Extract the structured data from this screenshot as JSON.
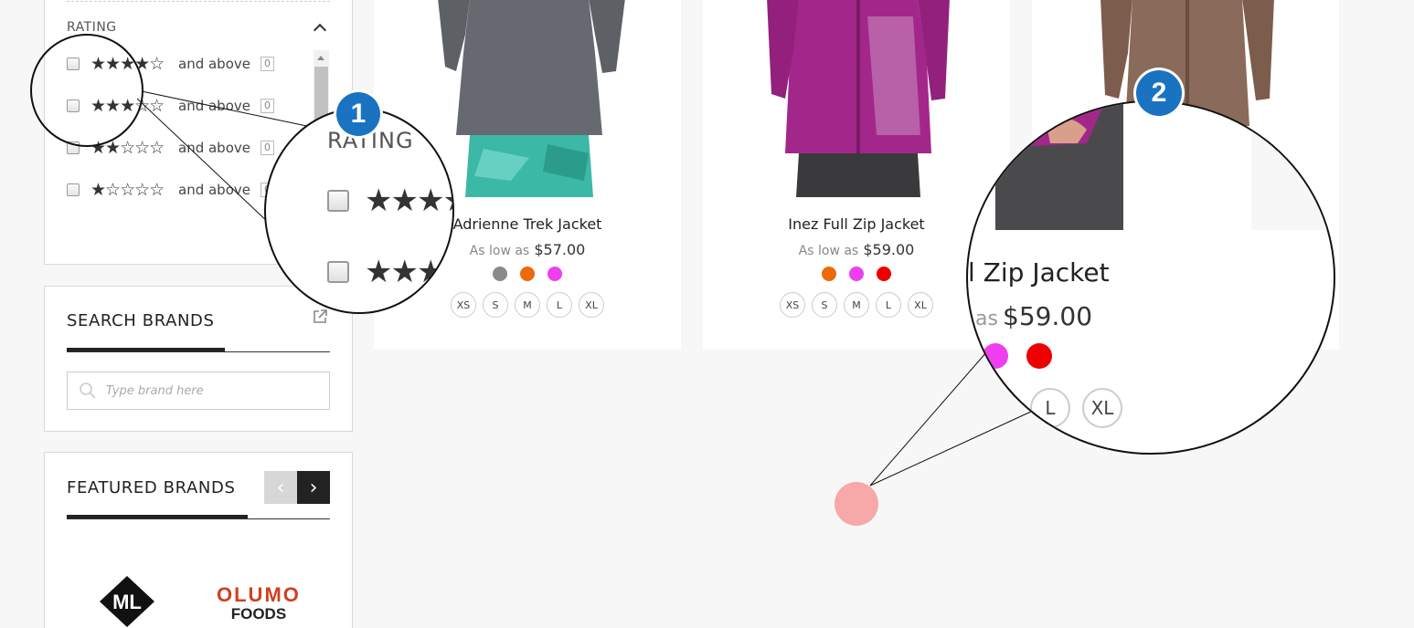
{
  "sidebar": {
    "rating": {
      "title": "RATING",
      "rows": [
        {
          "stars": "★★★★☆",
          "label": "and above",
          "count": "0"
        },
        {
          "stars": "★★★☆☆",
          "label": "and above",
          "count": "0"
        },
        {
          "stars": "★★☆☆☆",
          "label": "and above",
          "count": "0"
        },
        {
          "stars": "★☆☆☆☆",
          "label": "and above",
          "count": "0"
        }
      ]
    },
    "search_brands": {
      "title": "SEARCH BRANDS",
      "placeholder": "Type brand here"
    },
    "featured_brands": {
      "title": "FEATURED BRANDS",
      "prev": "‹",
      "next": "›",
      "brands": [
        {
          "name": "ML",
          "logo_icon": "ml-logo-icon"
        },
        {
          "name": "OLUMO",
          "subtitle": "FOODS",
          "logo_icon": "olumo-foods-logo"
        }
      ]
    }
  },
  "products": [
    {
      "name": "Adrienne Trek Jacket",
      "price_prefix": "As low as",
      "price": "$57.00",
      "swatches": [
        "#8a8a8a",
        "#ec6a0c",
        "#ee3ef0"
      ],
      "sizes": [
        "XS",
        "S",
        "M",
        "L",
        "XL"
      ]
    },
    {
      "name": "Inez Full Zip Jacket",
      "price_prefix": "As low as",
      "price": "$59.00",
      "swatches": [
        "#ec6a0c",
        "#ee3ef0",
        "#ee0000"
      ],
      "sizes": [
        "XS",
        "S",
        "M",
        "L",
        "XL"
      ]
    },
    {
      "name": "",
      "price_prefix": "",
      "price": "",
      "swatches": [],
      "sizes": []
    }
  ],
  "magnifier_1": {
    "badge": "1",
    "title": "RATING",
    "rows": [
      {
        "stars": "★★★★"
      },
      {
        "stars": "★★★"
      }
    ]
  },
  "magnifier_2": {
    "badge": "2",
    "name": "l Zip Jacket",
    "price_prefix": "as",
    "price": "$59.00",
    "swatches": [
      "#ee3ef0",
      "#ee0000"
    ],
    "sizes": [
      "L",
      "XL"
    ]
  },
  "colors": {
    "badge_blue": "#1a73c0",
    "click_marker": "#f7a8a8"
  }
}
